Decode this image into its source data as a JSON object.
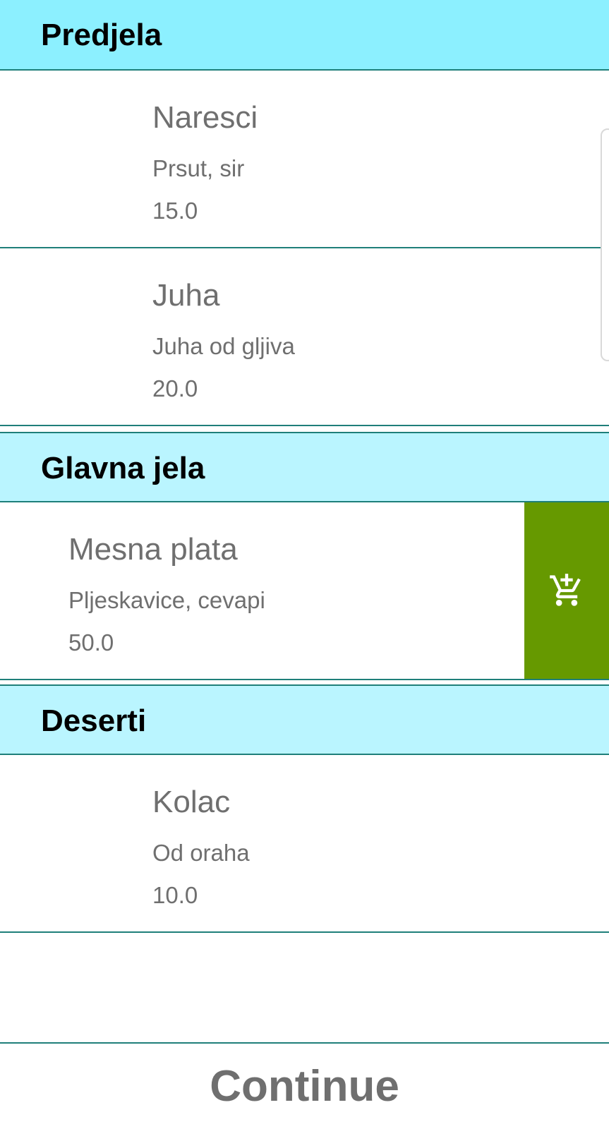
{
  "colors": {
    "header_first": "#8cf0ff",
    "header": "#baf5ff",
    "divider": "#1f7f7a",
    "action_green": "#669900",
    "text_gray": "#6f6f6f"
  },
  "sections": [
    {
      "title": "Predjela",
      "items": [
        {
          "name": "Naresci",
          "description": "Prsut, sir",
          "price": "15.0"
        },
        {
          "name": "Juha",
          "description": "Juha od gljiva",
          "price": "20.0"
        }
      ]
    },
    {
      "title": "Glavna jela",
      "items": [
        {
          "name": "Mesna plata",
          "description": "Pljeskavice, cevapi",
          "price": "50.0",
          "action_icon": "add-shopping-cart-icon"
        }
      ]
    },
    {
      "title": "Deserti",
      "items": [
        {
          "name": "Kolac",
          "description": "Od oraha",
          "price": "10.0"
        }
      ]
    }
  ],
  "footer": {
    "continue_label": "Continue"
  }
}
